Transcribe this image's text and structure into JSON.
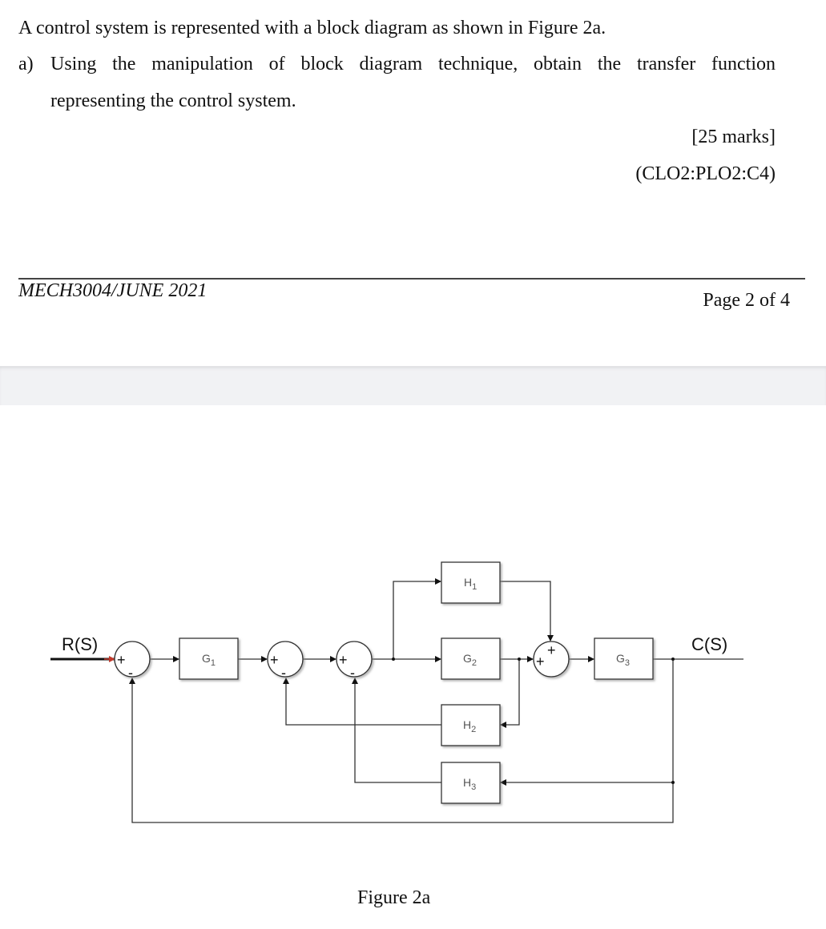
{
  "question": {
    "intro": "A control system is represented with a block diagram as shown in Figure 2a.",
    "part_a_marker": "a)",
    "part_a_line1": "Using the manipulation of block diagram technique, obtain the transfer function",
    "part_a_line2": "representing the control system.",
    "marks": "[25 marks]",
    "clo": "(CLO2:PLO2:C4)"
  },
  "footer": {
    "course": "MECH3004/JUNE 2021",
    "page": "Page 2 of 4"
  },
  "figure": {
    "caption": "Figure 2a",
    "input_label": "R(S)",
    "output_label": "C(S)",
    "blocks": {
      "G1": {
        "name": "G",
        "sub": "1"
      },
      "G2": {
        "name": "G",
        "sub": "2"
      },
      "G3": {
        "name": "G",
        "sub": "3"
      },
      "H1": {
        "name": "H",
        "sub": "1"
      },
      "H2": {
        "name": "H",
        "sub": "2"
      },
      "H3": {
        "name": "H",
        "sub": "3"
      }
    },
    "summing_junctions": [
      {
        "id": "S1",
        "signs": [
          "+",
          "-"
        ]
      },
      {
        "id": "S2",
        "signs": [
          "+",
          "-"
        ]
      },
      {
        "id": "S3",
        "signs": [
          "+",
          "-"
        ]
      },
      {
        "id": "S4",
        "signs": [
          "+",
          "+"
        ]
      }
    ],
    "input_arrow_color": "#c0392b"
  }
}
